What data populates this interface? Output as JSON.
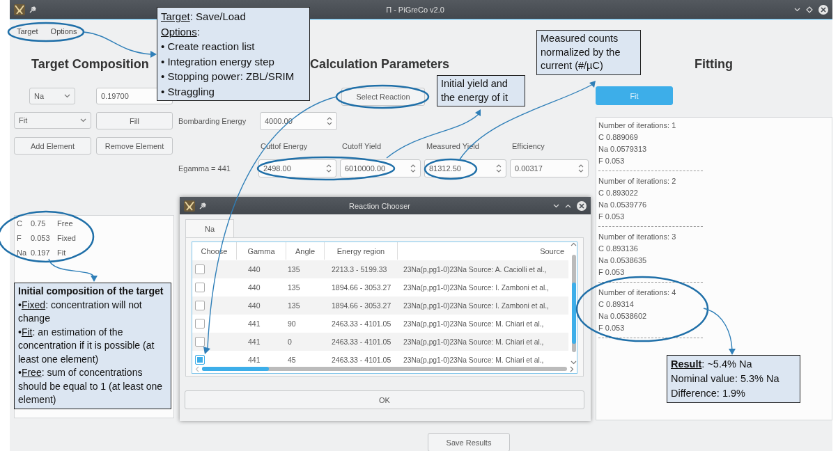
{
  "window": {
    "title": "Π - PiGreCo v2.0"
  },
  "menu": [
    {
      "label": "Target"
    },
    {
      "label": "Options"
    }
  ],
  "target_composition": {
    "heading": "Target Composition",
    "element_select": "Na",
    "concentration": "0.19700",
    "mode_select": "Fit",
    "fill_button": "Fill",
    "add_button": "Add Element",
    "remove_button": "Remove Element",
    "elements": [
      {
        "symbol": "C",
        "value": "0.75",
        "mode": "Free"
      },
      {
        "symbol": "F",
        "value": "0.053",
        "mode": "Fixed"
      },
      {
        "symbol": "Na",
        "value": "0.197",
        "mode": "Fit"
      }
    ]
  },
  "calculation_parameters": {
    "heading": "Calculation Parameters",
    "select_button": "Select Reaction",
    "bombarding_label": "Bombarding Energy",
    "bombarding_value": "4000.00",
    "columns": [
      "Cuttof Energy",
      "Cutoff Yield",
      "Measured Yield",
      "Efficiency"
    ],
    "row_label": "Egamma = 441",
    "values": [
      "2498.00",
      "6010000.00",
      "81312.50",
      "0.00317"
    ]
  },
  "fitting": {
    "heading": "Fitting",
    "fit_button": "Fit",
    "log": [
      {
        "lines": [
          "Number of iterations: 1",
          "C 0.889069",
          "Na 0.0579313",
          "F 0.053"
        ]
      },
      {
        "lines": [
          "Number of iterations: 2",
          "C 0.893022",
          "Na 0.0539776",
          "F 0.053"
        ]
      },
      {
        "lines": [
          "Number of iterations: 3",
          "C 0.893136",
          "Na 0.0538635",
          "F 0.053"
        ]
      },
      {
        "lines": [
          "Number of iterations: 4",
          "C 0.89314",
          "Na 0.0538602",
          "F 0.053"
        ]
      }
    ]
  },
  "save_button": "Save Results",
  "dialog": {
    "title": "Reaction Chooser",
    "tabs": [
      {
        "label": "Na",
        "selected": true
      }
    ],
    "columns": [
      "Choose",
      "Gamma",
      "Angle",
      "Energy region",
      "Source"
    ],
    "rows": [
      {
        "checked": false,
        "gamma": "440",
        "angle": "135",
        "energy_region": "2213.3 - 5199.33",
        "source": "23Na(p,pg1-0)23Na Source:  A. Caciolli et al.,"
      },
      {
        "checked": false,
        "gamma": "440",
        "angle": "135",
        "energy_region": "1894.66 - 3053.27",
        "source": "23Na(p,pg1-0)23Na Source:  I. Zamboni et al.,"
      },
      {
        "checked": false,
        "gamma": "440",
        "angle": "135",
        "energy_region": "1894.66 - 3053.27",
        "source": "23Na(p,pg1-0)23Na Source:  I. Zamboni et al.,"
      },
      {
        "checked": false,
        "gamma": "441",
        "angle": "90",
        "energy_region": "2463.33 - 4101.05",
        "source": "23Na(p,pg1-0)23Na Source:  M. Chiari et al.,"
      },
      {
        "checked": false,
        "gamma": "441",
        "angle": "0",
        "energy_region": "2463.33 - 4101.05",
        "source": "23Na(p,pg1-0)23Na Source:  M. Chiari et al.,"
      },
      {
        "checked": true,
        "gamma": "441",
        "angle": "45",
        "energy_region": "2463.33 - 4101.05",
        "source": "23Na(p,pg1-0)23Na Source:  M. Chiari et al.,"
      }
    ],
    "ok_button": "OK"
  },
  "annotations": [
    {
      "kind": "menu_note",
      "items": [
        {
          "kind": "term",
          "term": "Target",
          "text": ": Save/Load"
        },
        {
          "kind": "term",
          "term": "Options",
          "text": ":"
        },
        {
          "kind": "plain",
          "text": "• Create reaction list"
        },
        {
          "kind": "plain",
          "text": "• Integration energy step"
        },
        {
          "kind": "plain",
          "text": "• Stopping power: ZBL/SRIM"
        },
        {
          "kind": "plain",
          "text": "• Straggling"
        }
      ]
    },
    {
      "kind": "yield_note",
      "items": [
        {
          "kind": "plain",
          "text": "Initial yield and the energy of it"
        }
      ]
    },
    {
      "kind": "counts_note",
      "items": [
        {
          "kind": "plain",
          "text": "Measured counts normalized by the current (#/µC)"
        }
      ]
    },
    {
      "kind": "composition_note",
      "items": [
        {
          "kind": "heading",
          "text": "Initial composition of the target"
        },
        {
          "kind": "term",
          "prefix": "•",
          "term": "Fixed",
          "text": ": concentration will not change"
        },
        {
          "kind": "term",
          "prefix": "•",
          "term": "Fit",
          "text": ": an estimation of the concentration if it is possible (at least one element)"
        },
        {
          "kind": "term",
          "prefix": "•",
          "term": "Free",
          "text": ": sum of concentrations should be equal to 1 (at least one element)"
        }
      ]
    },
    {
      "kind": "result_note",
      "items": [
        {
          "kind": "strong_term",
          "term": "Result",
          "text": ": ~5.4% Na"
        },
        {
          "kind": "plain",
          "text": "Nominal value: 5.3% Na"
        },
        {
          "kind": "plain",
          "text": "Difference: 1.9%"
        }
      ]
    }
  ]
}
